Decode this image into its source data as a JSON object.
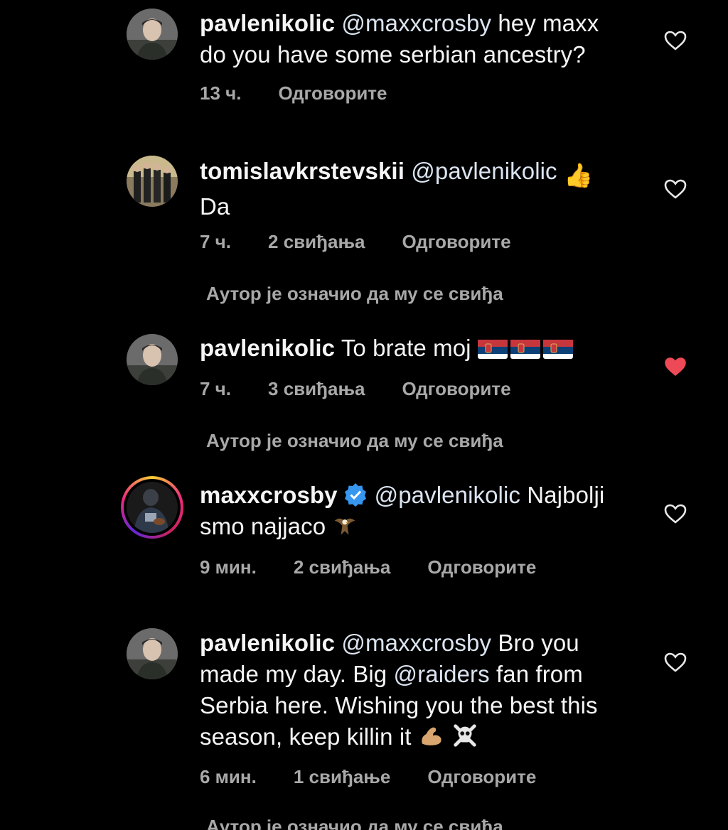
{
  "comments": [
    {
      "username": "pavlenikolic",
      "text_mention": "@maxxcrosby",
      "text_line1": " hey maxx",
      "text_line2": "do you have some serbian ancestry?",
      "time": "13 ч.",
      "likes": "",
      "reply": "Одговорите",
      "liked": false
    },
    {
      "username": "tomislavkrstevskii",
      "text_mention": "@pavlenikolic",
      "text_line1": "👍",
      "text_line2": "Da",
      "time": "7 ч.",
      "likes": "2 свиђања",
      "reply": "Одговорите",
      "liked": false,
      "author_liked_note": "Аутор је означио да му се свиђа"
    },
    {
      "username": "pavlenikolic",
      "text_line1": "To brate moj",
      "time": "7 ч.",
      "likes": "3 свиђања",
      "reply": "Одговорите",
      "liked": true,
      "author_liked_note": "Аутор је означио да му се свиђа"
    },
    {
      "username": "maxxcrosby",
      "text_mention": "@pavlenikolic",
      "text_line1": " Najbolji",
      "text_line2": "smo najjaco",
      "time": "9 мин.",
      "likes": "2 свиђања",
      "reply": "Одговорите",
      "liked": false
    },
    {
      "username": "pavlenikolic",
      "text_mention": "@maxxcrosby",
      "text_line1": " Bro you",
      "text_line2_a": "made my day. Big  ",
      "text_line2_mention": "@raiders",
      "text_line2_b": " fan from",
      "text_line3": "Serbia here. Wishing you the best this",
      "text_line4": "season, keep killin it",
      "time": "6 мин.",
      "likes": "1 свиђање",
      "reply": "Одговорите",
      "liked": false,
      "author_liked_note": "Аутор је означио да му се свиђа"
    }
  ],
  "colors": {
    "background": "#000000",
    "text": "#f5f5f5",
    "meta": "#a8a8a8",
    "liked_heart": "#ed4956",
    "verified": "#3797f0"
  },
  "icons": [
    "heart-outline-icon",
    "heart-filled-icon",
    "verified-badge-icon"
  ]
}
